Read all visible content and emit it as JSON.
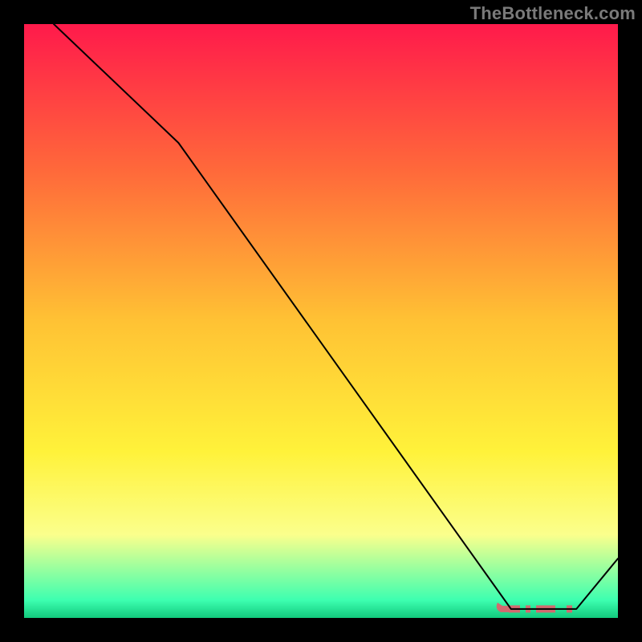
{
  "attribution": "TheBottleneck.com",
  "chart_data": {
    "type": "line",
    "title": "",
    "xlabel": "",
    "ylabel": "",
    "xlim": [
      0,
      100
    ],
    "ylim": [
      0,
      100
    ],
    "background_gradient": {
      "direction": "vertical",
      "stops": [
        {
          "pos": 0.0,
          "color": "#ff1a4b"
        },
        {
          "pos": 0.25,
          "color": "#ff6a3a"
        },
        {
          "pos": 0.5,
          "color": "#ffc234"
        },
        {
          "pos": 0.72,
          "color": "#fff23a"
        },
        {
          "pos": 0.86,
          "color": "#fbff8c"
        },
        {
          "pos": 0.97,
          "color": "#3dffb0"
        },
        {
          "pos": 1.0,
          "color": "#12c97d"
        }
      ]
    },
    "series": [
      {
        "name": "bottleneck-line",
        "color": "#000000",
        "stroke_width": 2,
        "x": [
          5,
          26,
          82,
          93,
          100
        ],
        "values": [
          100,
          80,
          1.5,
          1.5,
          10
        ]
      }
    ],
    "marker_band": {
      "name": "optimal-range",
      "color": "#d26a6f",
      "y": 1.5,
      "x_start": 80,
      "x_end": 93,
      "style": "dashed"
    }
  }
}
